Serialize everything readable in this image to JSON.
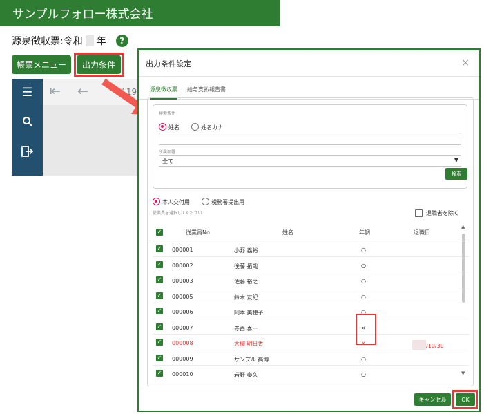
{
  "app": {
    "company_name": "サンプルフォロー株式会社",
    "page_title_prefix": "源泉徴収票:令和",
    "page_title_suffix": "年",
    "help_icon": "?",
    "menu_button": "帳票メニュー",
    "conditions_button": "出力条件",
    "page_indicator": "/ 19",
    "nav_icons": [
      "menu-icon",
      "search-icon",
      "exit-icon"
    ],
    "accent_color": "#2e7d32",
    "highlight_color": "#e53935"
  },
  "dialog": {
    "title": "出力条件設定",
    "close": "×",
    "tabs": [
      {
        "label": "源泉徴収票",
        "active": true
      },
      {
        "label": "給与支払報告書",
        "active": false
      }
    ],
    "search": {
      "section_label": "検索条件",
      "name_options": [
        {
          "label": "姓名",
          "selected": true
        },
        {
          "label": "姓名カナ",
          "selected": false
        }
      ],
      "input_value": "",
      "department_label": "所属部署",
      "department_value": "全て",
      "department_caret": "▼",
      "search_button": "検索"
    },
    "print_targets": [
      {
        "label": "本人交付用",
        "selected": true
      },
      {
        "label": "税務署提出用",
        "selected": false
      }
    ],
    "hint": "従業員を選択してください",
    "exclude_retired": "退職者を除く",
    "columns": {
      "employee_no": "従業員No",
      "name": "姓名",
      "year_end_adjustment": "年調",
      "retirement_date": "退職日"
    },
    "rows": [
      {
        "no": "000001",
        "name": "小野 義裕",
        "adj": "○",
        "retire": "",
        "highlight": false
      },
      {
        "no": "000002",
        "name": "後藤 拓哉",
        "adj": "○",
        "retire": "",
        "highlight": false
      },
      {
        "no": "000003",
        "name": "佐藤 裕之",
        "adj": "○",
        "retire": "",
        "highlight": false
      },
      {
        "no": "000005",
        "name": "鈴木 友紀",
        "adj": "○",
        "retire": "",
        "highlight": false
      },
      {
        "no": "000006",
        "name": "岡本 美穂子",
        "adj": "○",
        "retire": "",
        "highlight": false
      },
      {
        "no": "000007",
        "name": "寺西 喜一",
        "adj": "×",
        "retire": "",
        "highlight": false
      },
      {
        "no": "000008",
        "name": "大柳 明日香",
        "adj": "×",
        "retire": "/10/30",
        "highlight": true
      },
      {
        "no": "000009",
        "name": "サンプル 高博",
        "adj": "○",
        "retire": "",
        "highlight": false
      },
      {
        "no": "000010",
        "name": "岩野 泰久",
        "adj": "○",
        "retire": "",
        "highlight": false
      }
    ],
    "cancel_button": "キャンセル",
    "ok_button": "OK"
  }
}
